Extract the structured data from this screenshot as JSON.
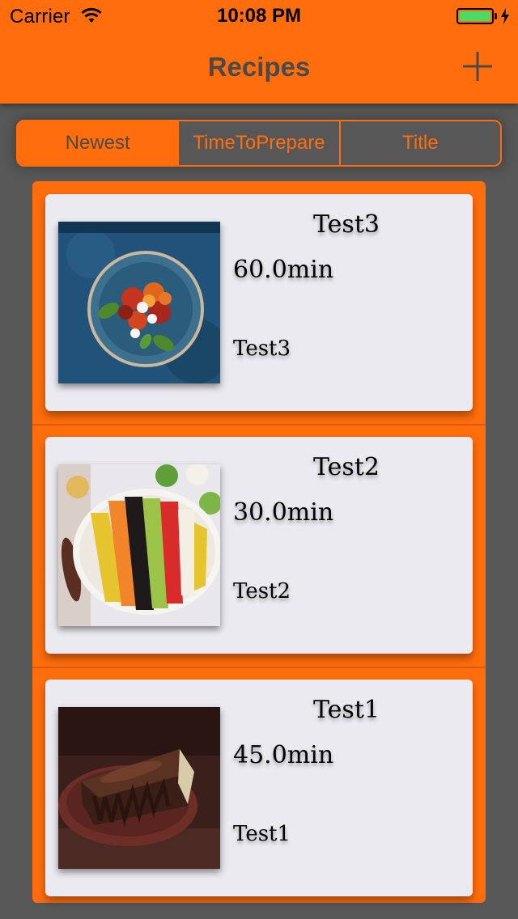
{
  "status_bar": {
    "carrier": "Carrier",
    "time": "10:08 PM",
    "battery_color": "#4CD964"
  },
  "nav": {
    "title": "Recipes",
    "add_icon": "plus-icon"
  },
  "sort_control": {
    "segments": [
      "Newest",
      "TimeToPrepare",
      "Title"
    ],
    "selected": "Newest"
  },
  "recipes": [
    {
      "title": "Test3",
      "time": "60.0min",
      "description": "Test3",
      "image": "salad-bowl-photo"
    },
    {
      "title": "Test2",
      "time": "30.0min",
      "description": "Test2",
      "image": "cobb-salad-photo"
    },
    {
      "title": "Test1",
      "time": "45.0min",
      "description": "Test1",
      "image": "chocolate-cake-photo"
    }
  ],
  "colors": {
    "accent": "#FF6D0D",
    "background": "#575757",
    "card": "#EBEAF0",
    "title_text": "#4A4A4A"
  }
}
